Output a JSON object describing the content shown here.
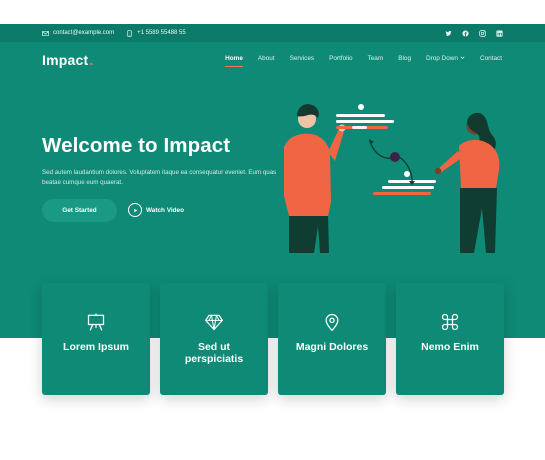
{
  "topbar": {
    "email": "contact@example.com",
    "phone": "+1 5589 55488 55",
    "socials": [
      "twitter-icon",
      "facebook-icon",
      "instagram-icon",
      "linkedin-icon"
    ]
  },
  "header": {
    "brand": "Impact",
    "brand_dot": ".",
    "nav": [
      {
        "label": "Home",
        "active": true
      },
      {
        "label": "About"
      },
      {
        "label": "Services"
      },
      {
        "label": "Portfolio"
      },
      {
        "label": "Team"
      },
      {
        "label": "Blog"
      },
      {
        "label": "Drop Down",
        "dropdown": true
      },
      {
        "label": "Contact"
      }
    ]
  },
  "hero": {
    "title": "Welcome to Impact",
    "subtitle": "Sed autem laudantium dolores. Voluptatem itaque ea consequatur eveniet. Eum quas beatae cumque eum quaerat.",
    "cta_primary": "Get Started",
    "cta_video": "Watch Video"
  },
  "cards": [
    {
      "title": "Lorem Ipsum",
      "icon": "easel-icon"
    },
    {
      "title": "Sed ut perspiciatis",
      "icon": "gem-icon"
    },
    {
      "title": "Magni Dolores",
      "icon": "geo-pin-icon"
    },
    {
      "title": "Nemo Enim",
      "icon": "command-icon"
    }
  ],
  "colors": {
    "primary": "#0e8a76",
    "topbar": "#0b7a68",
    "accent": "#f2764f",
    "white": "#ffffff"
  }
}
